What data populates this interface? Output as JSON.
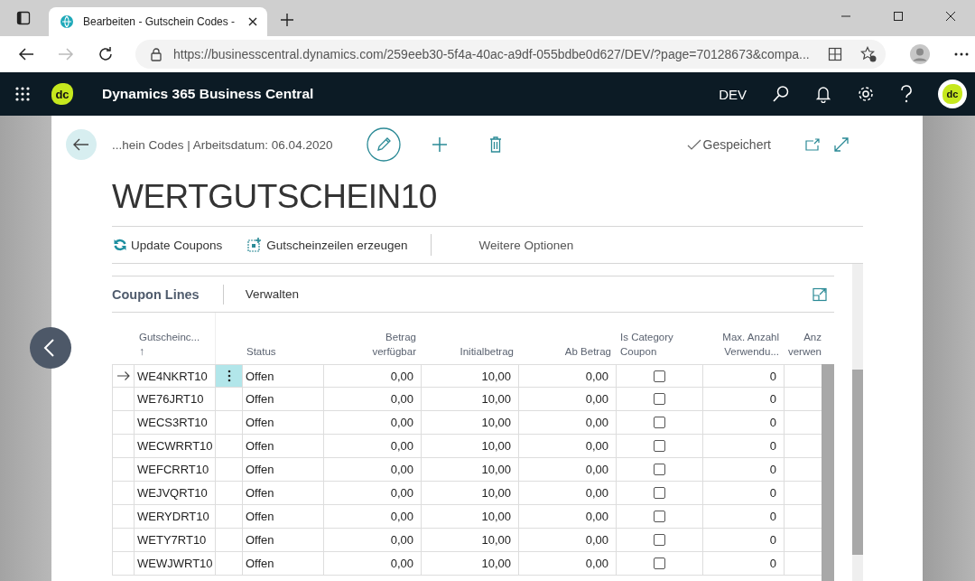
{
  "browser": {
    "tab_title": "Bearbeiten - Gutschein Codes -",
    "url": "https://businesscentral.dynamics.com/259eeb30-5f4a-40ac-a9df-055bdbe0d627/DEV/?page=70128673&compa..."
  },
  "app_header": {
    "logo": "dc",
    "app_name": "Dynamics 365 Business Central",
    "environment": "DEV",
    "avatar": "dc"
  },
  "card": {
    "breadcrumb": "...hein Codes | Arbeitsdatum: 06.04.2020",
    "saved_status": "Gespeichert",
    "title": "WERTGUTSCHEIN10",
    "actions": [
      {
        "kind": "refresh",
        "label": "Update Coupons"
      },
      {
        "kind": "generate",
        "label": "Gutscheinzeilen erzeugen"
      },
      {
        "kind": "more",
        "label": "Weitere Optionen"
      }
    ]
  },
  "part": {
    "title": "Coupon Lines",
    "action": "Verwalten",
    "table": {
      "columns": [
        {
          "kind": "marker"
        },
        {
          "kind": "text",
          "lines": [
            "Gutscheinc..."
          ],
          "sort_indicator": "↑"
        },
        {
          "kind": "menu"
        },
        {
          "kind": "text",
          "lines": [
            "Status"
          ]
        },
        {
          "kind": "number",
          "lines": [
            "Betrag",
            "verfügbar"
          ]
        },
        {
          "kind": "number",
          "lines": [
            "Initialbetrag"
          ]
        },
        {
          "kind": "number",
          "lines": [
            "Ab Betrag"
          ]
        },
        {
          "kind": "check",
          "lines": [
            "Is Category",
            "Coupon"
          ]
        },
        {
          "kind": "number",
          "lines": [
            "Max. Anzahl",
            "Verwendu..."
          ]
        },
        {
          "kind": "number",
          "lines": [
            "Anz",
            "verwen"
          ]
        }
      ],
      "rows": [
        {
          "selected": true,
          "code": "WE4NKRT10",
          "status": "Offen",
          "betrag_verfuegbar": "0,00",
          "initialbetrag": "10,00",
          "ab_betrag": "0,00",
          "is_category_coupon": false,
          "max_anzahl": "0"
        },
        {
          "selected": false,
          "code": "WE76JRT10",
          "status": "Offen",
          "betrag_verfuegbar": "0,00",
          "initialbetrag": "10,00",
          "ab_betrag": "0,00",
          "is_category_coupon": false,
          "max_anzahl": "0"
        },
        {
          "selected": false,
          "code": "WECS3RT10",
          "status": "Offen",
          "betrag_verfuegbar": "0,00",
          "initialbetrag": "10,00",
          "ab_betrag": "0,00",
          "is_category_coupon": false,
          "max_anzahl": "0"
        },
        {
          "selected": false,
          "code": "WECWRRT10",
          "status": "Offen",
          "betrag_verfuegbar": "0,00",
          "initialbetrag": "10,00",
          "ab_betrag": "0,00",
          "is_category_coupon": false,
          "max_anzahl": "0"
        },
        {
          "selected": false,
          "code": "WEFCRRT10",
          "status": "Offen",
          "betrag_verfuegbar": "0,00",
          "initialbetrag": "10,00",
          "ab_betrag": "0,00",
          "is_category_coupon": false,
          "max_anzahl": "0"
        },
        {
          "selected": false,
          "code": "WEJVQRT10",
          "status": "Offen",
          "betrag_verfuegbar": "0,00",
          "initialbetrag": "10,00",
          "ab_betrag": "0,00",
          "is_category_coupon": false,
          "max_anzahl": "0"
        },
        {
          "selected": false,
          "code": "WERYDRT10",
          "status": "Offen",
          "betrag_verfuegbar": "0,00",
          "initialbetrag": "10,00",
          "ab_betrag": "0,00",
          "is_category_coupon": false,
          "max_anzahl": "0"
        },
        {
          "selected": false,
          "code": "WETY7RT10",
          "status": "Offen",
          "betrag_verfuegbar": "0,00",
          "initialbetrag": "10,00",
          "ab_betrag": "0,00",
          "is_category_coupon": false,
          "max_anzahl": "0"
        },
        {
          "selected": false,
          "code": "WEWJWRT10",
          "status": "Offen",
          "betrag_verfuegbar": "0,00",
          "initialbetrag": "10,00",
          "ab_betrag": "0,00",
          "is_category_coupon": false,
          "max_anzahl": "0"
        }
      ]
    }
  }
}
